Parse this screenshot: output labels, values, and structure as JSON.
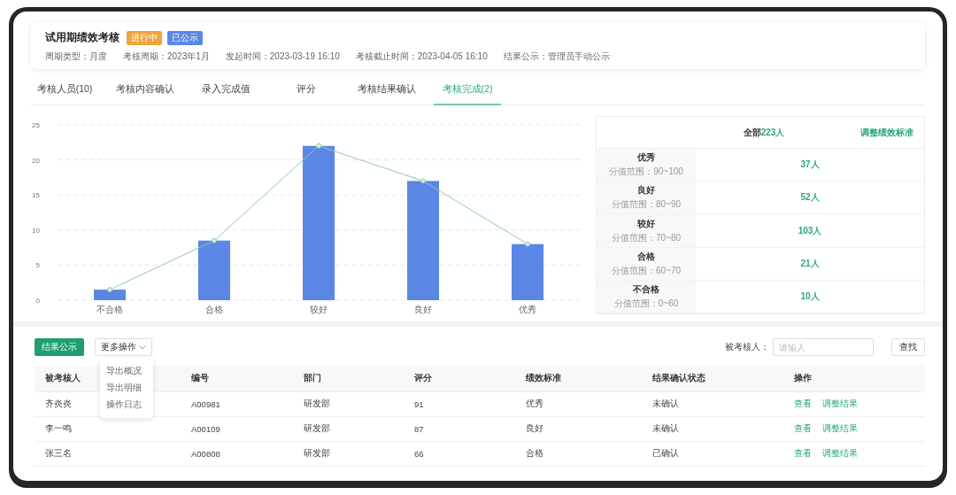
{
  "header": {
    "title": "试用期绩效考核",
    "tags": [
      {
        "label": "进行中",
        "color": "#f0a53a"
      },
      {
        "label": "已公示",
        "color": "#5b86e5"
      }
    ],
    "meta": [
      "周期类型：月度",
      "考核周期：2023年1月",
      "发起时间：2023-03-19  16:10",
      "考核截止时间：2023-04-05  16:10",
      "结果公示：管理员手动公示"
    ]
  },
  "tabs": [
    {
      "label": "考核人员(10)",
      "selected": false
    },
    {
      "label": "考核内容确认",
      "selected": false
    },
    {
      "label": "录入完成值",
      "selected": false
    },
    {
      "label": "评分",
      "selected": false
    },
    {
      "label": "考核结果确认",
      "selected": false
    },
    {
      "label": "考核完成(2)",
      "selected": true
    }
  ],
  "chart": {
    "chart_data": {
      "type": "bar",
      "categories": [
        "不合格",
        "合格",
        "较好",
        "良好",
        "优秀"
      ],
      "ylim": [
        0,
        25
      ],
      "yticks": [
        0,
        5,
        10,
        15,
        20,
        25
      ],
      "series": [
        {
          "type": "bar",
          "color": "#5b86e5",
          "values": [
            1.5,
            8.5,
            22,
            17,
            8
          ]
        },
        {
          "type": "line",
          "color": "#8fcab0",
          "marker": "circle",
          "values": [
            1.5,
            8.5,
            22,
            17,
            8
          ]
        }
      ],
      "grid": true
    }
  },
  "summary": {
    "total_label": "全部",
    "total_value": "223人",
    "action": "调整绩效标准",
    "levels": [
      {
        "name": "优秀",
        "range": "分值范围：90~100",
        "count": "37人"
      },
      {
        "name": "良好",
        "range": "分值范围：80~90",
        "count": "52人"
      },
      {
        "name": "较好",
        "range": "分值范围：70~80",
        "count": "103人"
      },
      {
        "name": "合格",
        "range": "分值范围：60~70",
        "count": "21人"
      },
      {
        "name": "不合格",
        "range": "分值范围：0~60",
        "count": "10人"
      }
    ]
  },
  "toolbar": {
    "publish_button": "结果公示",
    "more_button": "更多操作",
    "menu": [
      "导出概况",
      "导出明细",
      "操作日志"
    ],
    "search_label": "被考核人：",
    "search_placeholder": "请输入",
    "find_button": "查找"
  },
  "table": {
    "columns": [
      "被考核人",
      "编号",
      "部门",
      "评分",
      "绩效标准",
      "结果确认状态",
      "操作"
    ],
    "rows": [
      {
        "cells": [
          "齐炎炎",
          "A00981",
          "研发部",
          "91",
          "优秀",
          "未确认"
        ],
        "actions": [
          "查看",
          "调整结果"
        ]
      },
      {
        "cells": [
          "李一鸣",
          "A00109",
          "研发部",
          "87",
          "良好",
          "未确认"
        ],
        "actions": [
          "查看",
          "调整结果"
        ]
      },
      {
        "cells": [
          "张三名",
          "A00808",
          "研发部",
          "66",
          "合格",
          "已确认"
        ],
        "actions": [
          "查看",
          "调整结果"
        ]
      }
    ]
  }
}
